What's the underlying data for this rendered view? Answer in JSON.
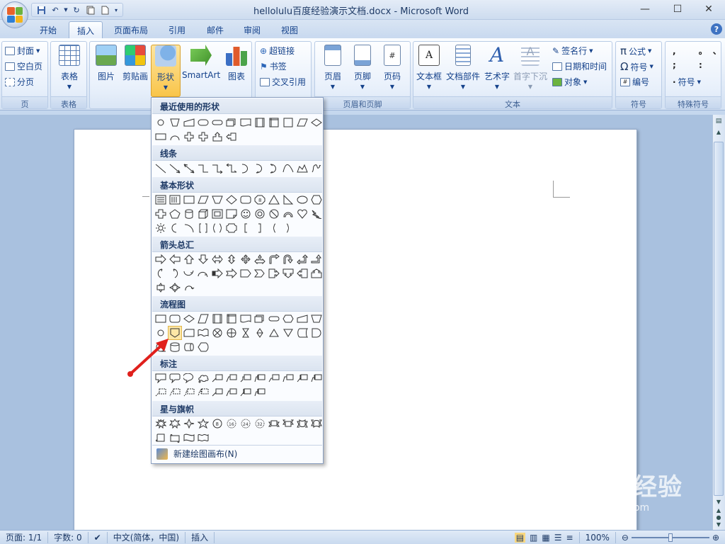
{
  "window": {
    "title": "hellolulu百度经验演示文档.docx - Microsoft Word"
  },
  "tabs": [
    {
      "label": "开始"
    },
    {
      "label": "插入"
    },
    {
      "label": "页面布局"
    },
    {
      "label": "引用"
    },
    {
      "label": "邮件"
    },
    {
      "label": "审阅"
    },
    {
      "label": "视图"
    }
  ],
  "ribbon": {
    "pages": {
      "label": "页",
      "items": [
        {
          "label": "封面"
        },
        {
          "label": "空白页"
        },
        {
          "label": "分页"
        }
      ]
    },
    "tables": {
      "label": "表格",
      "button": "表格"
    },
    "illustrations": {
      "buttons": [
        {
          "label": "图片"
        },
        {
          "label": "剪贴画"
        },
        {
          "label": "形状"
        },
        {
          "label": "SmartArt"
        },
        {
          "label": "图表"
        }
      ]
    },
    "links": {
      "items": [
        {
          "label": "超链接"
        },
        {
          "label": "书签"
        },
        {
          "label": "交叉引用"
        }
      ]
    },
    "header_footer": {
      "label": "页眉和页脚",
      "buttons": [
        {
          "label": "页眉"
        },
        {
          "label": "页脚"
        },
        {
          "label": "页码"
        }
      ]
    },
    "text": {
      "label": "文本",
      "buttons": [
        {
          "label": "文本框"
        },
        {
          "label": "文档部件"
        },
        {
          "label": "艺术字"
        },
        {
          "label": "首字下沉"
        }
      ],
      "items": [
        {
          "label": "签名行"
        },
        {
          "label": "日期和时间"
        },
        {
          "label": "对象"
        }
      ]
    },
    "symbols": {
      "label": "符号",
      "items": [
        {
          "label": "公式"
        },
        {
          "label": "符号"
        },
        {
          "label": "编号"
        }
      ]
    },
    "special": {
      "label": "特殊符号",
      "items": [
        {
          "label": "符号"
        }
      ]
    }
  },
  "shapes_menu": {
    "sections": [
      {
        "title": "最近使用的形状"
      },
      {
        "title": "线条"
      },
      {
        "title": "基本形状"
      },
      {
        "title": "箭头总汇"
      },
      {
        "title": "流程图"
      },
      {
        "title": "标注"
      },
      {
        "title": "星与旗帜"
      }
    ],
    "new_canvas": "新建绘图画布(N)"
  },
  "status": {
    "page": "页面: 1/1",
    "words": "字数: 0",
    "language": "中文(简体，中国)",
    "mode": "插入",
    "zoom": "100%"
  },
  "watermark": {
    "brand": "Baidu经验",
    "url": "jingyan.baidu.com"
  }
}
